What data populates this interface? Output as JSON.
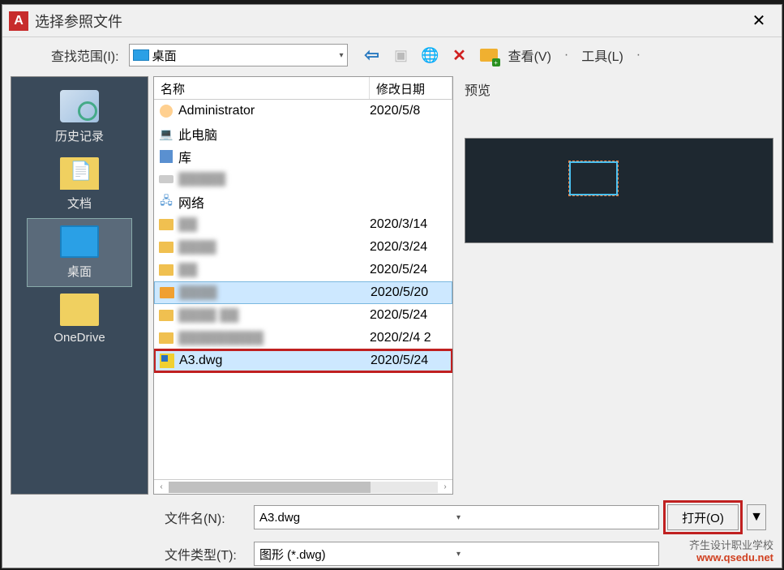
{
  "title": "选择参照文件",
  "close_glyph": "✕",
  "lookin": {
    "label": "查找范围(I):",
    "value": "桌面"
  },
  "toolbar": {
    "view_label": "查看(V)",
    "tools_label": "工具(L)",
    "dot": "·"
  },
  "sidebar": {
    "items": [
      {
        "label": "历史记录"
      },
      {
        "label": "文档"
      },
      {
        "label": "桌面"
      },
      {
        "label": "OneDrive"
      }
    ]
  },
  "filelist": {
    "col_name": "名称",
    "col_date": "修改日期",
    "rows": [
      {
        "name": "Administrator",
        "date": "2020/5/8",
        "icon": "user"
      },
      {
        "name": "此电脑",
        "date": "",
        "icon": "pc"
      },
      {
        "name": "库",
        "date": "",
        "icon": "lib"
      },
      {
        "name": "▓▓▓▓▓",
        "date": "",
        "icon": "drive",
        "blur": true
      },
      {
        "name": "网络",
        "date": "",
        "icon": "net"
      },
      {
        "name": "▓▓",
        "date": "2020/3/14",
        "icon": "folder",
        "blur": true
      },
      {
        "name": "▓▓▓▓",
        "date": "2020/3/24",
        "icon": "folder",
        "blur": true
      },
      {
        "name": "▓▓",
        "date": "2020/5/24",
        "icon": "folder",
        "blur": true
      },
      {
        "name": "▓▓▓▓",
        "date": "2020/5/20",
        "icon": "folder2",
        "blur": true,
        "selected": true
      },
      {
        "name": "▓▓▓▓ ▓▓",
        "date": "2020/5/24",
        "icon": "folder",
        "blur": true
      },
      {
        "name": "▓▓▓▓▓▓▓▓▓",
        "date": "2020/2/4 2",
        "icon": "folder",
        "blur": true
      },
      {
        "name": "A3.dwg",
        "date": "2020/5/24",
        "icon": "dwg",
        "selected": true,
        "highlight": true
      }
    ]
  },
  "preview_label": "预览",
  "filename": {
    "label": "文件名(N):",
    "value": "A3.dwg"
  },
  "filetype": {
    "label": "文件类型(T):",
    "value": "图形 (*.dwg)"
  },
  "open_btn": "打开(O)",
  "dropdown_glyph": "▼",
  "scroll_left": "‹",
  "scroll_right": "›",
  "watermark": {
    "line1": "齐生设计职业学校",
    "line2": "www.qsedu.net"
  }
}
